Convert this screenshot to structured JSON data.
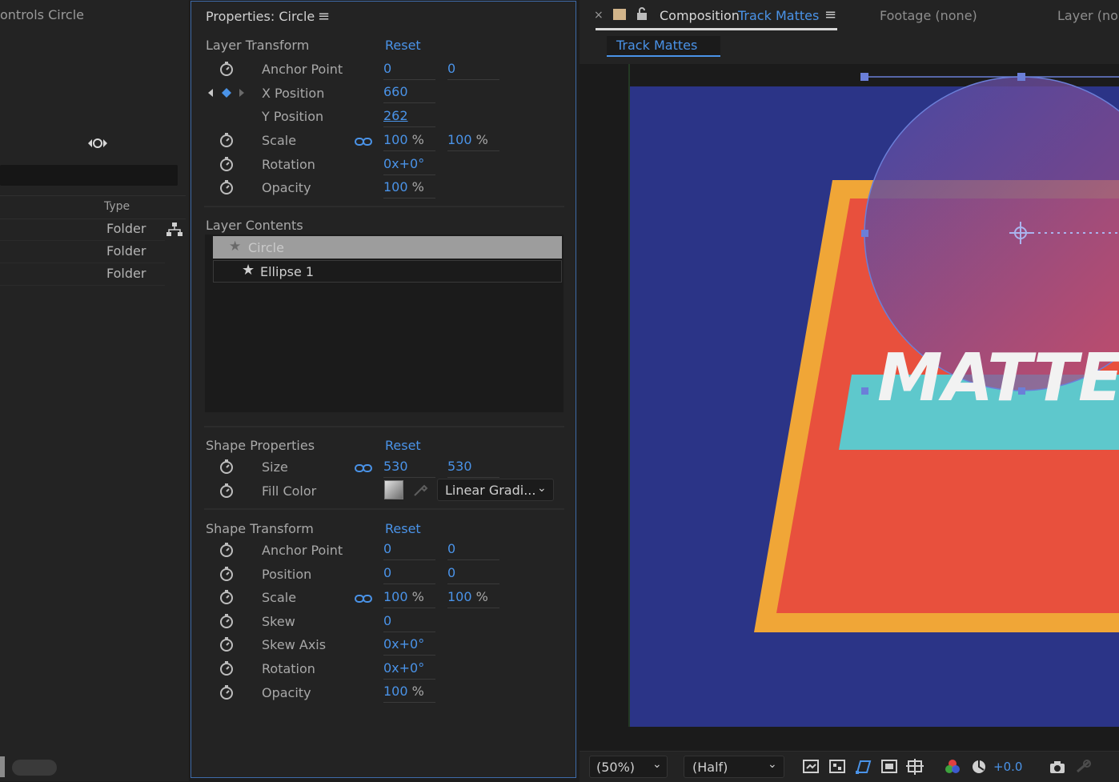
{
  "left_panel": {
    "title": "ontrols Circle",
    "type_header": "Type",
    "rows": [
      "Folder",
      "Folder",
      "Folder"
    ]
  },
  "properties": {
    "title": "Properties: Circle",
    "layer_transform": {
      "label": "Layer Transform",
      "reset": "Reset",
      "anchor_point": {
        "label": "Anchor Point",
        "x": "0",
        "y": "0"
      },
      "x_position": {
        "label": "X Position",
        "value": "660"
      },
      "y_position": {
        "label": "Y Position",
        "value": "262"
      },
      "scale": {
        "label": "Scale",
        "x": "100",
        "y": "100",
        "unit": "%"
      },
      "rotation": {
        "label": "Rotation",
        "value": "0x+0°"
      },
      "opacity": {
        "label": "Opacity",
        "value": "100",
        "unit": "%"
      }
    },
    "layer_contents": {
      "label": "Layer Contents",
      "items": [
        "Circle",
        "Ellipse 1"
      ]
    },
    "shape_properties": {
      "label": "Shape Properties",
      "reset": "Reset",
      "size": {
        "label": "Size",
        "w": "530",
        "h": "530"
      },
      "fill_color": {
        "label": "Fill Color",
        "type": "Linear Gradi..."
      }
    },
    "shape_transform": {
      "label": "Shape Transform",
      "reset": "Reset",
      "anchor_point": {
        "label": "Anchor Point",
        "x": "0",
        "y": "0"
      },
      "position": {
        "label": "Position",
        "x": "0",
        "y": "0"
      },
      "scale": {
        "label": "Scale",
        "x": "100",
        "y": "100",
        "unit": "%"
      },
      "skew": {
        "label": "Skew",
        "value": "0"
      },
      "skew_axis": {
        "label": "Skew Axis",
        "value": "0x+0°"
      },
      "rotation": {
        "label": "Rotation",
        "value": "0x+0°"
      },
      "opacity": {
        "label": "Opacity",
        "value": "100",
        "unit": "%"
      }
    }
  },
  "composition": {
    "tab_prefix": "Composition",
    "tab_name": "Track Mattes",
    "footage_tab": "Footage (none)",
    "layer_tab": "Layer (nor",
    "subtab": "Track Mattes",
    "canvas_text": "MATTE",
    "toolbar": {
      "zoom": "(50%)",
      "resolution": "(Half)",
      "exposure": "+0.0"
    },
    "colors": {
      "bg": "#2b3487",
      "frame": "#f0a637",
      "card": "#e8503d",
      "band": "#5ec8cc",
      "accent": "#4a93e8"
    }
  }
}
